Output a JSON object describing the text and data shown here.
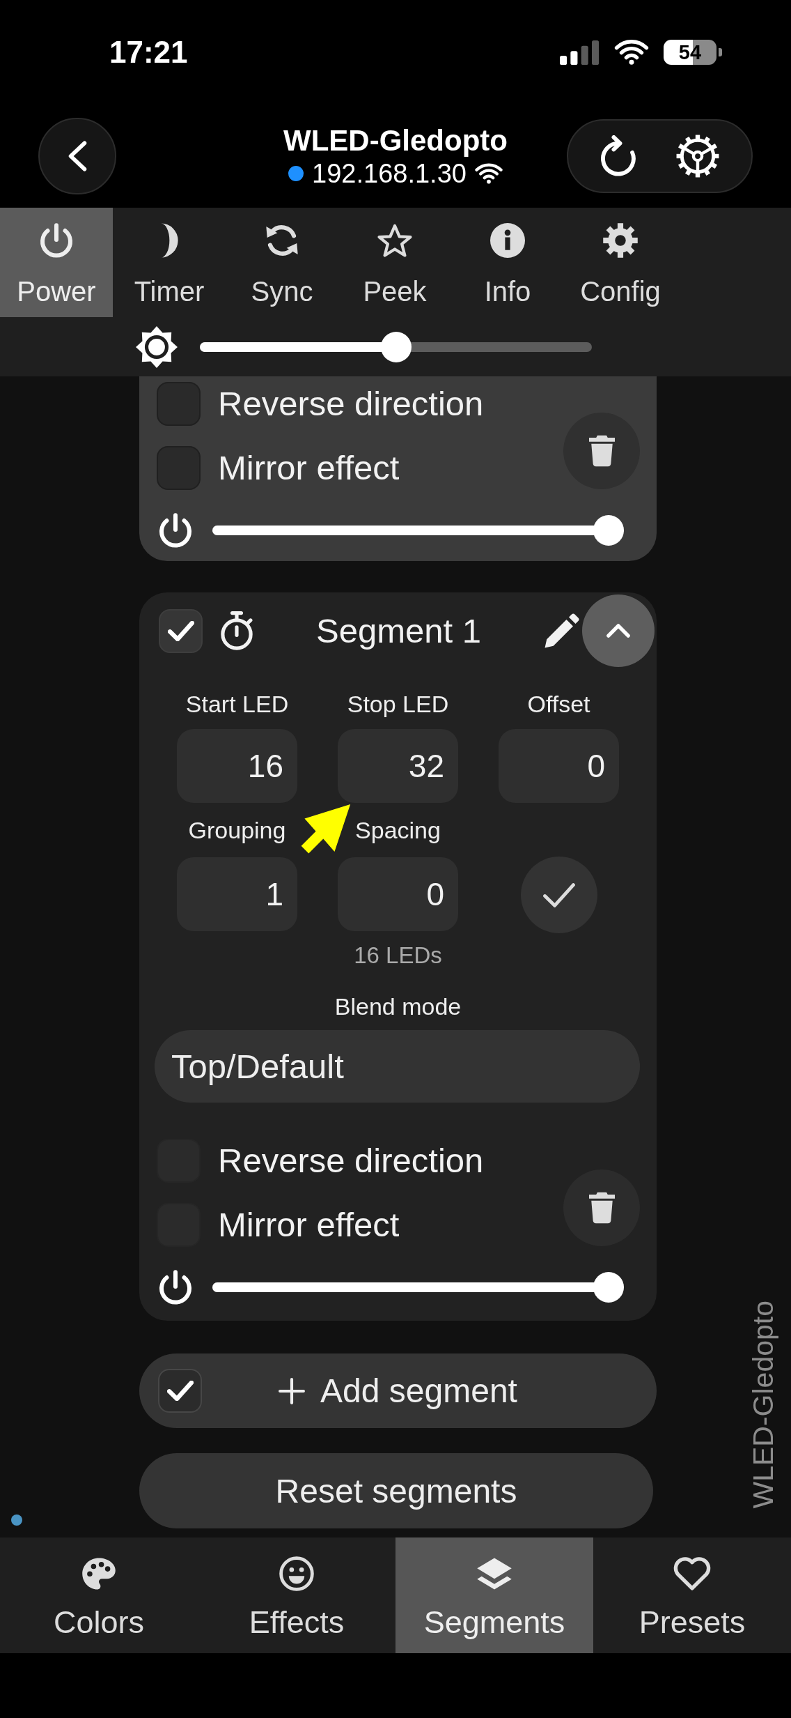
{
  "status_bar": {
    "time": "17:21",
    "battery": "54"
  },
  "header": {
    "title": "WLED-Gledopto",
    "address": "192.168.1.30"
  },
  "top_tabs": [
    {
      "label": "Power",
      "selected": true
    },
    {
      "label": "Timer",
      "selected": false
    },
    {
      "label": "Sync",
      "selected": false
    },
    {
      "label": "Peek",
      "selected": false
    },
    {
      "label": "Info",
      "selected": false
    },
    {
      "label": "Config",
      "selected": false
    }
  ],
  "brightness": {
    "level": 0.5
  },
  "segments": [
    {
      "highlighted": true,
      "options": [
        {
          "label": "Reverse direction",
          "checked": false
        },
        {
          "label": "Mirror effect",
          "checked": false
        }
      ],
      "level": 1
    },
    {
      "highlighted": false,
      "checked": true,
      "name": "Segment 1",
      "expanded": true,
      "fields": [
        {
          "label": "Start LED",
          "value": "16"
        },
        {
          "label": "Stop LED",
          "value": "32"
        },
        {
          "label": "Offset",
          "value": "0"
        },
        {
          "label": "Grouping",
          "value": "1"
        },
        {
          "label": "Spacing",
          "value": "0"
        }
      ],
      "led_count": "16 LEDs",
      "blend_mode": {
        "label": "Blend mode",
        "value": "Top/Default"
      },
      "options": [
        {
          "label": "Reverse direction",
          "checked": false
        },
        {
          "label": "Mirror effect",
          "checked": false
        }
      ],
      "level": 1
    }
  ],
  "add_segment": {
    "checked": true,
    "label": "Add segment"
  },
  "reset_button": "Reset segments",
  "device_label": "WLED-Gledopto",
  "bottom_tabs": [
    {
      "label": "Colors",
      "selected": false
    },
    {
      "label": "Effects",
      "selected": false
    },
    {
      "label": "Segments",
      "selected": true
    },
    {
      "label": "Presets",
      "selected": false
    }
  ]
}
